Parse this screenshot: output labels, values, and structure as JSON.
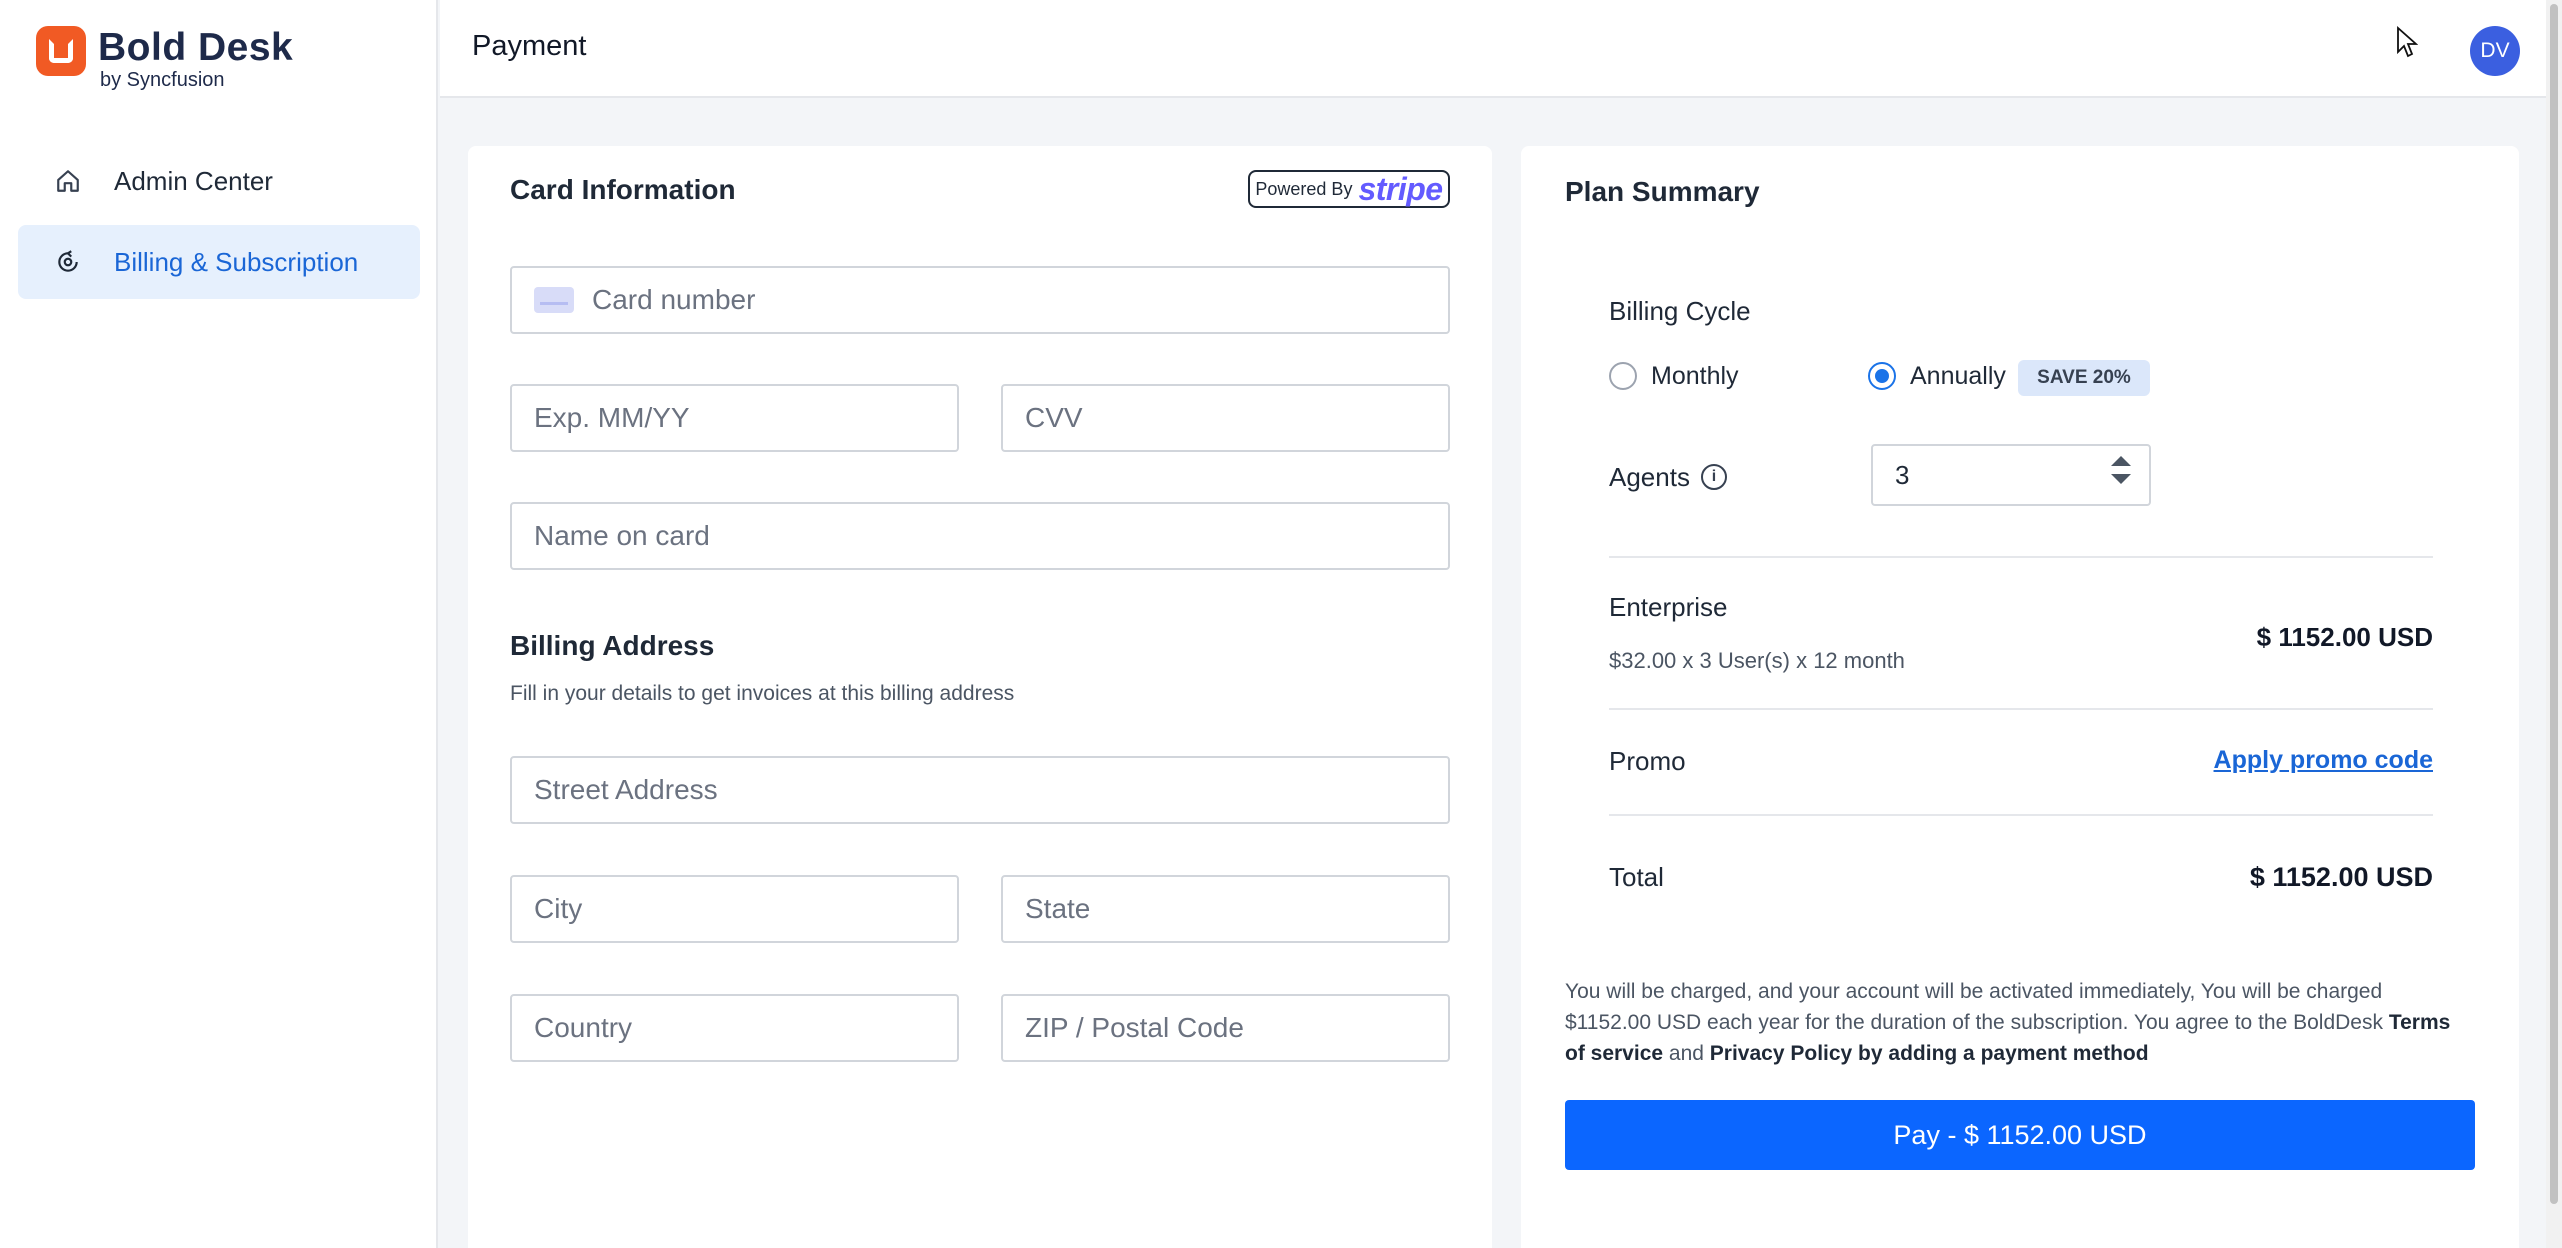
{
  "brand": {
    "name": "Bold Desk",
    "sub": "by Syncfusion",
    "color": "#f15a24"
  },
  "sidebar": {
    "items": [
      {
        "label": "Admin Center",
        "icon": "home-icon"
      },
      {
        "label": "Billing & Subscription",
        "icon": "billing-icon",
        "active": true
      }
    ]
  },
  "header": {
    "title": "Payment",
    "avatar": "DV"
  },
  "card_info": {
    "title": "Card Information",
    "powered_by": "Powered By",
    "stripe": "stripe",
    "card_number_placeholder": "Card number",
    "exp_placeholder": "Exp. MM/YY",
    "cvv_placeholder": "CVV",
    "name_placeholder": "Name on card"
  },
  "billing_address": {
    "title": "Billing Address",
    "subtitle": "Fill in your details to get invoices at this billing address",
    "street_placeholder": "Street Address",
    "city_placeholder": "City",
    "state_placeholder": "State",
    "country_placeholder": "Country",
    "zip_placeholder": "ZIP / Postal Code"
  },
  "plan_summary": {
    "title": "Plan Summary",
    "billing_cycle_label": "Billing Cycle",
    "monthly_label": "Monthly",
    "annually_label": "Annually",
    "selected_cycle": "Annually",
    "save_badge": "SAVE 20%",
    "agents_label": "Agents",
    "agents_value": "3",
    "plan_name": "Enterprise",
    "plan_detail": "$32.00 x 3 User(s) x 12 month",
    "plan_price": "$ 1152.00 USD",
    "promo_label": "Promo",
    "promo_link": "Apply promo code",
    "total_label": "Total",
    "total_price": "$ 1152.00 USD",
    "note_text": "You will be charged, and your account will be activated immediately, You will be charged $1152.00 USD each year for the duration of the subscription. You agree to the BoldDesk",
    "terms_link": "Terms of service",
    "and_text": "and",
    "privacy_link": "Privacy Policy by adding a payment method",
    "pay_button": "Pay - $ 1152.00 USD"
  },
  "colors": {
    "accent": "#0b66ff",
    "active_nav_bg": "#e6f0fd",
    "avatar_bg": "#3b5fe0"
  }
}
